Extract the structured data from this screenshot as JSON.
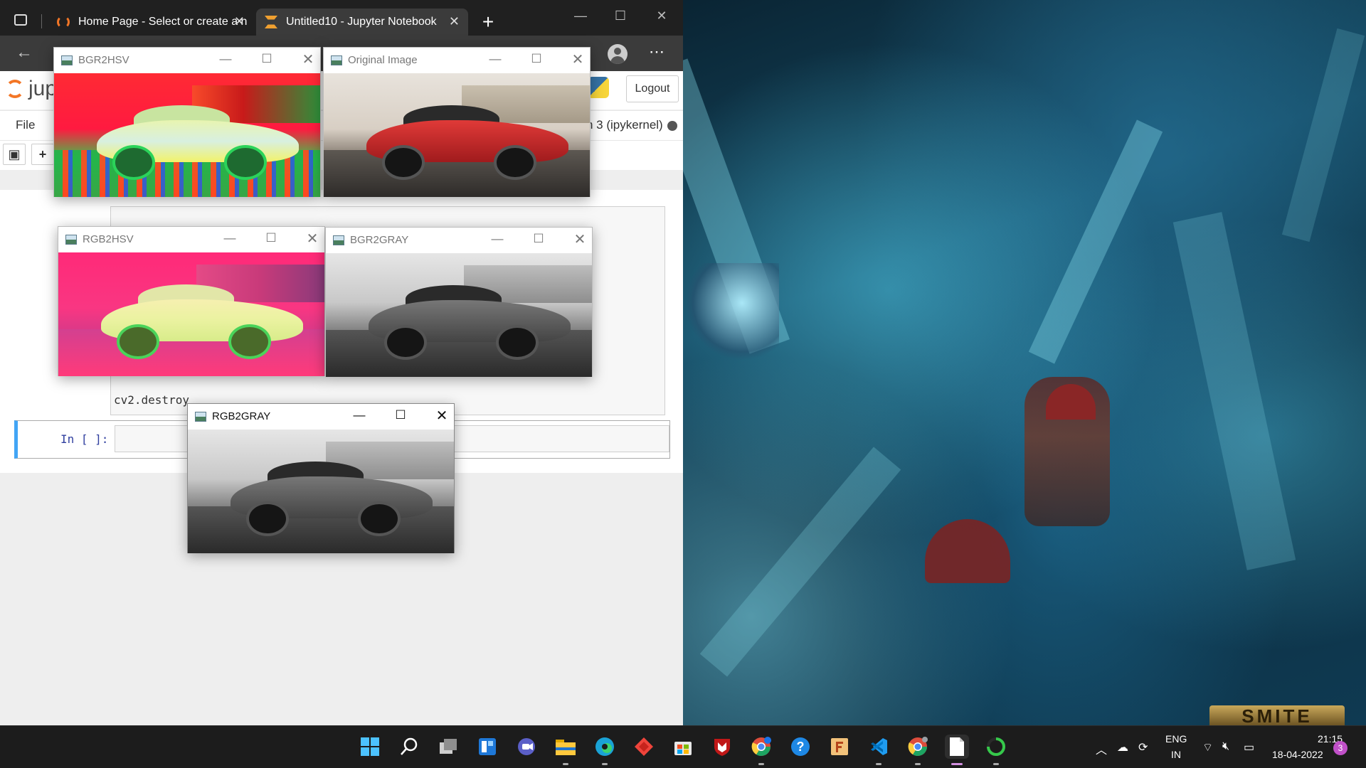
{
  "browser": {
    "tabs": [
      {
        "label": "Home Page - Select or create a n",
        "icon": "jupyter-icon"
      },
      {
        "label": "Untitled10 - Jupyter Notebook",
        "icon": "hourglass-icon",
        "active": true
      }
    ],
    "new_tab_symbol": "+",
    "window_controls": {
      "minimize": "—",
      "maximize": "☐",
      "close": "✕"
    }
  },
  "jupyter": {
    "logo_text": "jup",
    "logout_label": "Logout",
    "menu": {
      "file": "File"
    },
    "kernel_label": "n 3 (ipykernel)",
    "code_line": "cv2.destroy",
    "in_prompt": "In [ ]:"
  },
  "cv_windows": [
    {
      "id": "bgr2hsv",
      "title": "BGR2HSV"
    },
    {
      "id": "original",
      "title": "Original Image"
    },
    {
      "id": "rgb2hsv",
      "title": "RGB2HSV"
    },
    {
      "id": "bgr2gray",
      "title": "BGR2GRAY"
    },
    {
      "id": "rgb2gray",
      "title": "RGB2GRAY",
      "active": true
    }
  ],
  "desktop": {
    "game_logo": "SMITE"
  },
  "taskbar": {
    "apps": [
      "start-icon",
      "search-icon",
      "task-view-icon",
      "widgets-icon",
      "teams-chat-icon",
      "file-explorer-icon",
      "edge-icon",
      "anydesk-icon",
      "store-icon",
      "mcafee-icon",
      "chrome-icon",
      "help-icon",
      "app-f-icon",
      "vscode-icon",
      "chrome-dev-icon",
      "notepad-icon",
      "loading-app-icon"
    ],
    "language": {
      "line1": "ENG",
      "line2": "IN"
    },
    "time": "21:15",
    "date": "18-04-2022",
    "notification_count": "3"
  },
  "colors": {
    "jupyter_orange": "#f37626",
    "cell_active_blue": "#42a5f5",
    "taskbar": "#1c1c1c"
  }
}
